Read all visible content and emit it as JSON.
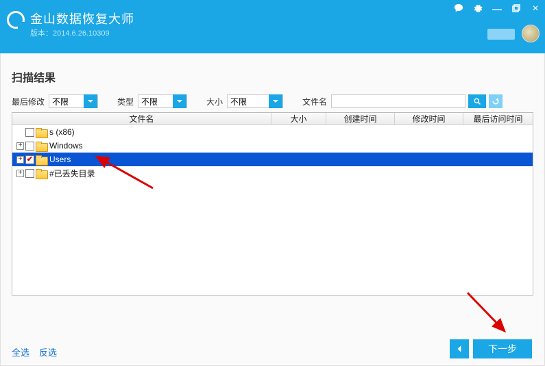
{
  "header": {
    "title": "金山数据恢复大师",
    "version_label": "版本：",
    "version": "2014.6.26.10309"
  },
  "section_title": "扫描结果",
  "filters": {
    "last_modified_label": "最后修改",
    "last_modified_value": "不限",
    "type_label": "类型",
    "type_value": "不限",
    "size_label": "大小",
    "size_value": "不限",
    "name_label": "文件名"
  },
  "columns": {
    "name": "文件名",
    "size": "大小",
    "ctime": "创建时间",
    "mtime": "修改时间",
    "atime": "最后访问时间"
  },
  "tree": [
    {
      "name": "s (x86)",
      "checked": false,
      "expandable": false,
      "selected": false
    },
    {
      "name": "Windows",
      "checked": false,
      "expandable": true,
      "selected": false
    },
    {
      "name": "Users",
      "checked": true,
      "expandable": true,
      "selected": true
    },
    {
      "name": "#已丢失目录",
      "checked": false,
      "expandable": true,
      "selected": false
    }
  ],
  "footer": {
    "select_all": "全选",
    "invert": "反选",
    "next": "下一步"
  }
}
